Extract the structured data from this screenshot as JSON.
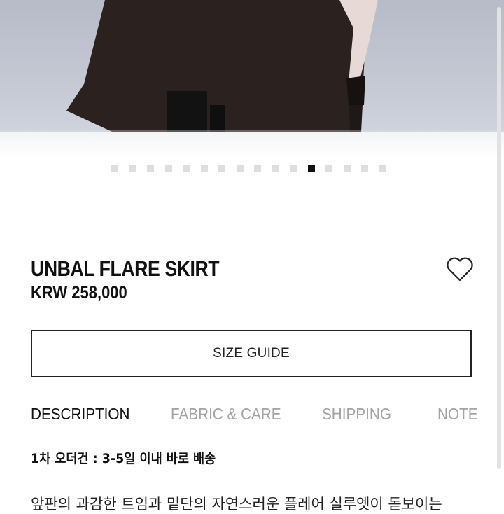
{
  "gallery": {
    "slide_count": 16,
    "active_index": 11
  },
  "product": {
    "name": "UNBAL FLARE SKIRT",
    "price": "KRW 258,000",
    "wishlist_icon": "heart-outline-icon"
  },
  "size_guide": {
    "label": "SIZE GUIDE"
  },
  "tabs": [
    {
      "label": "DESCRIPTION",
      "active": true
    },
    {
      "label": "FABRIC & CARE",
      "active": false
    },
    {
      "label": "SHIPPING",
      "active": false
    },
    {
      "label": "NOTE",
      "active": false
    }
  ],
  "description": {
    "notice": "1차 오더건 : 3-5일 이내 바로 배송",
    "body_line1": "앞판의 과감한 트임과 밑단의 자연스러운 플레어 실루엣이 돋보이는"
  },
  "colors": {
    "text": "#111111",
    "tab_inactive": "#a3a3a3",
    "active_dot": "#111111",
    "inactive_dot": "#dedede"
  }
}
